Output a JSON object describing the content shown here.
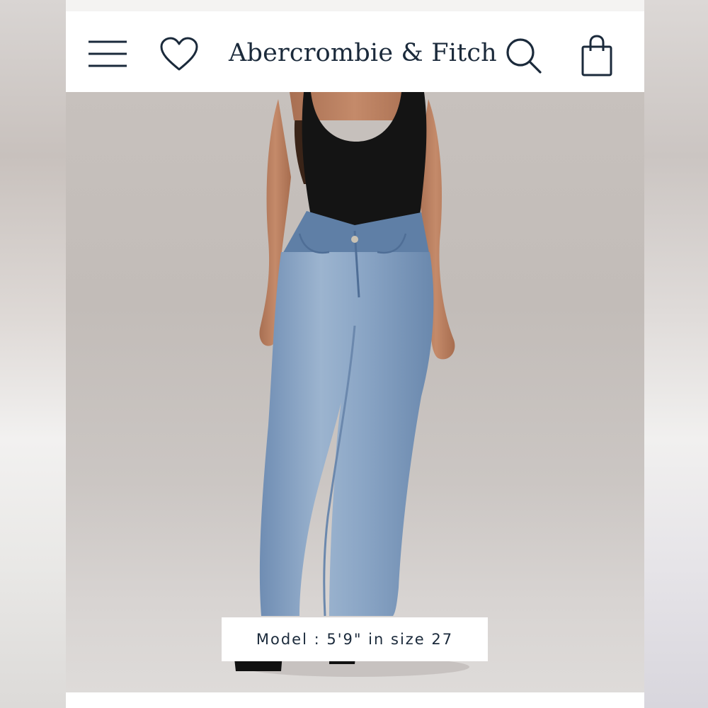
{
  "header": {
    "brand": "Abercrombie & Fitch",
    "icons": [
      "menu-icon",
      "heart-icon",
      "search-icon",
      "shopping-bag-icon"
    ]
  },
  "product_image": {
    "caption": "Model : 5'9\" in size 27"
  },
  "colors": {
    "brand_navy": "#1b2a3b",
    "background": "#ffffff",
    "photo_backdrop": "#c7c1bd",
    "denim": "#8ea7c6"
  }
}
